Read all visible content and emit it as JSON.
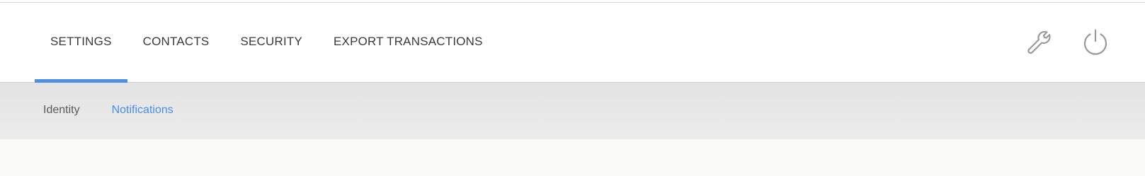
{
  "header": {
    "tabs": [
      {
        "label": "SETTINGS",
        "active": true
      },
      {
        "label": "CONTACTS",
        "active": false
      },
      {
        "label": "SECURITY",
        "active": false
      },
      {
        "label": "EXPORT TRANSACTIONS",
        "active": false
      }
    ],
    "actions": [
      {
        "icon": "wrench-icon"
      },
      {
        "icon": "power-icon"
      }
    ]
  },
  "sub_nav": {
    "tabs": [
      {
        "label": "Identity",
        "active": false
      },
      {
        "label": "Notifications",
        "active": true
      }
    ]
  },
  "colors": {
    "accent": "#4a8ee6",
    "tab_text": "#3a3a3a",
    "icon": "#9a9a9a",
    "sub_header_bg": "#e6e6e6",
    "content_bg": "#fafaf8"
  }
}
